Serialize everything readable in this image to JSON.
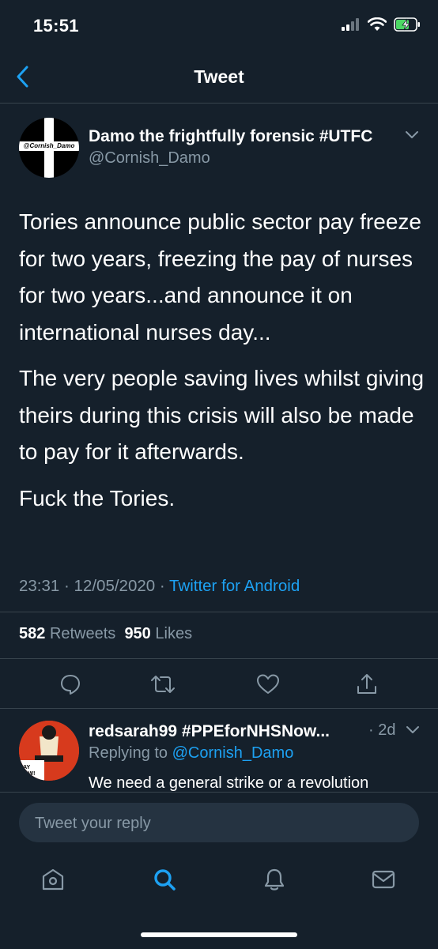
{
  "status_bar": {
    "time": "15:51",
    "icons": [
      "signal-icon",
      "wifi-icon",
      "battery-charging-icon"
    ]
  },
  "header": {
    "title": "Tweet",
    "back_icon": "chevron-left-icon"
  },
  "tweet": {
    "avatar_text": "@Cornish_Damo",
    "display_name": "Damo the frightfully forensic #UTFC",
    "handle": "@Cornish_Damo",
    "paragraphs": [
      "Tories announce public sector pay freeze for two years, freezing the pay of nurses for two years...and announce it on international nurses day...",
      "The very people saving lives whilst giving theirs during this crisis will also be made to pay for it afterwards.",
      "Fuck the Tories."
    ],
    "time": "23:31",
    "date": "12/05/2020",
    "separator": "·",
    "source": "Twitter for Android",
    "retweets_count": "582",
    "retweets_label": "Retweets",
    "likes_count": "950",
    "likes_label": "Likes"
  },
  "actions": [
    "reply-icon",
    "retweet-icon",
    "like-icon",
    "share-icon"
  ],
  "reply": {
    "display_name": "redsarah99 #PPEforNHSNow...",
    "time": "· 2d",
    "replying_prefix": "Replying to",
    "replying_handle": "@Cornish_Damo",
    "text": "We need a general strike or a revolution",
    "avatar_text": "PAY NOW!"
  },
  "composer": {
    "placeholder": "Tweet your reply"
  },
  "tab_bar": [
    "home-icon",
    "search-icon",
    "notifications-icon",
    "messages-icon"
  ],
  "colors": {
    "background": "#15202b",
    "accent": "#1da1f2",
    "muted": "#8899a6",
    "divider": "#38444d"
  }
}
